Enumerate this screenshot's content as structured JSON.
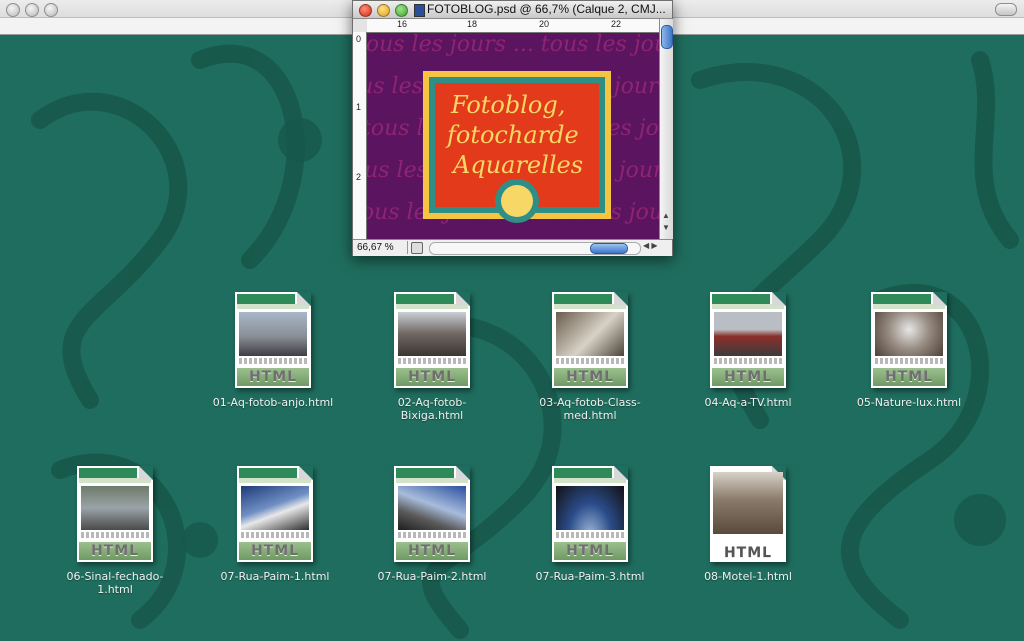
{
  "desktop": {
    "background_color": "#1f6d5e"
  },
  "photoshop_window": {
    "title": "FOTOBLOG.psd @ 66,7% (Calque 2, CMJ...",
    "ruler_top_labels": [
      "16",
      "18",
      "20",
      "22"
    ],
    "ruler_left_labels": [
      "0",
      "1",
      "2"
    ],
    "zoom_level": "66,67 %",
    "canvas_logo_text": [
      "Fotoblog,",
      "fotocharde",
      "Aquarelles"
    ],
    "canvas_background_text": "tous les jours ... tous les jours ..."
  },
  "files": [
    {
      "name": "01-Aq-fotob-anjo.html",
      "badge": "HTML"
    },
    {
      "name": "02-Aq-fotob-Bixiga.html",
      "badge": "HTML"
    },
    {
      "name": "03-Aq-fotob-Class-med.html",
      "badge": "HTML"
    },
    {
      "name": "04-Aq-a-TV.html",
      "badge": "HTML"
    },
    {
      "name": "05-Nature-lux.html",
      "badge": "HTML"
    },
    {
      "name": "06-Sinal-fechado-1.html",
      "badge": "HTML"
    },
    {
      "name": "07-Rua-Paim-1.html",
      "badge": "HTML"
    },
    {
      "name": "07-Rua-Paim-2.html",
      "badge": "HTML"
    },
    {
      "name": "07-Rua-Paim-3.html",
      "badge": "HTML"
    },
    {
      "name": "08-Motel-1.html",
      "badge": "HTML"
    }
  ]
}
